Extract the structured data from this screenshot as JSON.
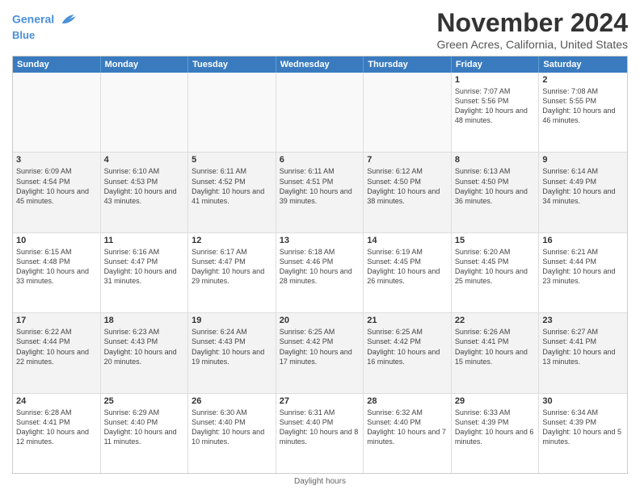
{
  "logo": {
    "line1": "General",
    "line2": "Blue"
  },
  "title": "November 2024",
  "subtitle": "Green Acres, California, United States",
  "days_of_week": [
    "Sunday",
    "Monday",
    "Tuesday",
    "Wednesday",
    "Thursday",
    "Friday",
    "Saturday"
  ],
  "footer": "Daylight hours",
  "weeks": [
    [
      {
        "day": "",
        "info": ""
      },
      {
        "day": "",
        "info": ""
      },
      {
        "day": "",
        "info": ""
      },
      {
        "day": "",
        "info": ""
      },
      {
        "day": "",
        "info": ""
      },
      {
        "day": "1",
        "info": "Sunrise: 7:07 AM\nSunset: 5:56 PM\nDaylight: 10 hours and 48 minutes."
      },
      {
        "day": "2",
        "info": "Sunrise: 7:08 AM\nSunset: 5:55 PM\nDaylight: 10 hours and 46 minutes."
      }
    ],
    [
      {
        "day": "3",
        "info": "Sunrise: 6:09 AM\nSunset: 4:54 PM\nDaylight: 10 hours and 45 minutes."
      },
      {
        "day": "4",
        "info": "Sunrise: 6:10 AM\nSunset: 4:53 PM\nDaylight: 10 hours and 43 minutes."
      },
      {
        "day": "5",
        "info": "Sunrise: 6:11 AM\nSunset: 4:52 PM\nDaylight: 10 hours and 41 minutes."
      },
      {
        "day": "6",
        "info": "Sunrise: 6:11 AM\nSunset: 4:51 PM\nDaylight: 10 hours and 39 minutes."
      },
      {
        "day": "7",
        "info": "Sunrise: 6:12 AM\nSunset: 4:50 PM\nDaylight: 10 hours and 38 minutes."
      },
      {
        "day": "8",
        "info": "Sunrise: 6:13 AM\nSunset: 4:50 PM\nDaylight: 10 hours and 36 minutes."
      },
      {
        "day": "9",
        "info": "Sunrise: 6:14 AM\nSunset: 4:49 PM\nDaylight: 10 hours and 34 minutes."
      }
    ],
    [
      {
        "day": "10",
        "info": "Sunrise: 6:15 AM\nSunset: 4:48 PM\nDaylight: 10 hours and 33 minutes."
      },
      {
        "day": "11",
        "info": "Sunrise: 6:16 AM\nSunset: 4:47 PM\nDaylight: 10 hours and 31 minutes."
      },
      {
        "day": "12",
        "info": "Sunrise: 6:17 AM\nSunset: 4:47 PM\nDaylight: 10 hours and 29 minutes."
      },
      {
        "day": "13",
        "info": "Sunrise: 6:18 AM\nSunset: 4:46 PM\nDaylight: 10 hours and 28 minutes."
      },
      {
        "day": "14",
        "info": "Sunrise: 6:19 AM\nSunset: 4:45 PM\nDaylight: 10 hours and 26 minutes."
      },
      {
        "day": "15",
        "info": "Sunrise: 6:20 AM\nSunset: 4:45 PM\nDaylight: 10 hours and 25 minutes."
      },
      {
        "day": "16",
        "info": "Sunrise: 6:21 AM\nSunset: 4:44 PM\nDaylight: 10 hours and 23 minutes."
      }
    ],
    [
      {
        "day": "17",
        "info": "Sunrise: 6:22 AM\nSunset: 4:44 PM\nDaylight: 10 hours and 22 minutes."
      },
      {
        "day": "18",
        "info": "Sunrise: 6:23 AM\nSunset: 4:43 PM\nDaylight: 10 hours and 20 minutes."
      },
      {
        "day": "19",
        "info": "Sunrise: 6:24 AM\nSunset: 4:43 PM\nDaylight: 10 hours and 19 minutes."
      },
      {
        "day": "20",
        "info": "Sunrise: 6:25 AM\nSunset: 4:42 PM\nDaylight: 10 hours and 17 minutes."
      },
      {
        "day": "21",
        "info": "Sunrise: 6:25 AM\nSunset: 4:42 PM\nDaylight: 10 hours and 16 minutes."
      },
      {
        "day": "22",
        "info": "Sunrise: 6:26 AM\nSunset: 4:41 PM\nDaylight: 10 hours and 15 minutes."
      },
      {
        "day": "23",
        "info": "Sunrise: 6:27 AM\nSunset: 4:41 PM\nDaylight: 10 hours and 13 minutes."
      }
    ],
    [
      {
        "day": "24",
        "info": "Sunrise: 6:28 AM\nSunset: 4:41 PM\nDaylight: 10 hours and 12 minutes."
      },
      {
        "day": "25",
        "info": "Sunrise: 6:29 AM\nSunset: 4:40 PM\nDaylight: 10 hours and 11 minutes."
      },
      {
        "day": "26",
        "info": "Sunrise: 6:30 AM\nSunset: 4:40 PM\nDaylight: 10 hours and 10 minutes."
      },
      {
        "day": "27",
        "info": "Sunrise: 6:31 AM\nSunset: 4:40 PM\nDaylight: 10 hours and 8 minutes."
      },
      {
        "day": "28",
        "info": "Sunrise: 6:32 AM\nSunset: 4:40 PM\nDaylight: 10 hours and 7 minutes."
      },
      {
        "day": "29",
        "info": "Sunrise: 6:33 AM\nSunset: 4:39 PM\nDaylight: 10 hours and 6 minutes."
      },
      {
        "day": "30",
        "info": "Sunrise: 6:34 AM\nSunset: 4:39 PM\nDaylight: 10 hours and 5 minutes."
      }
    ]
  ]
}
